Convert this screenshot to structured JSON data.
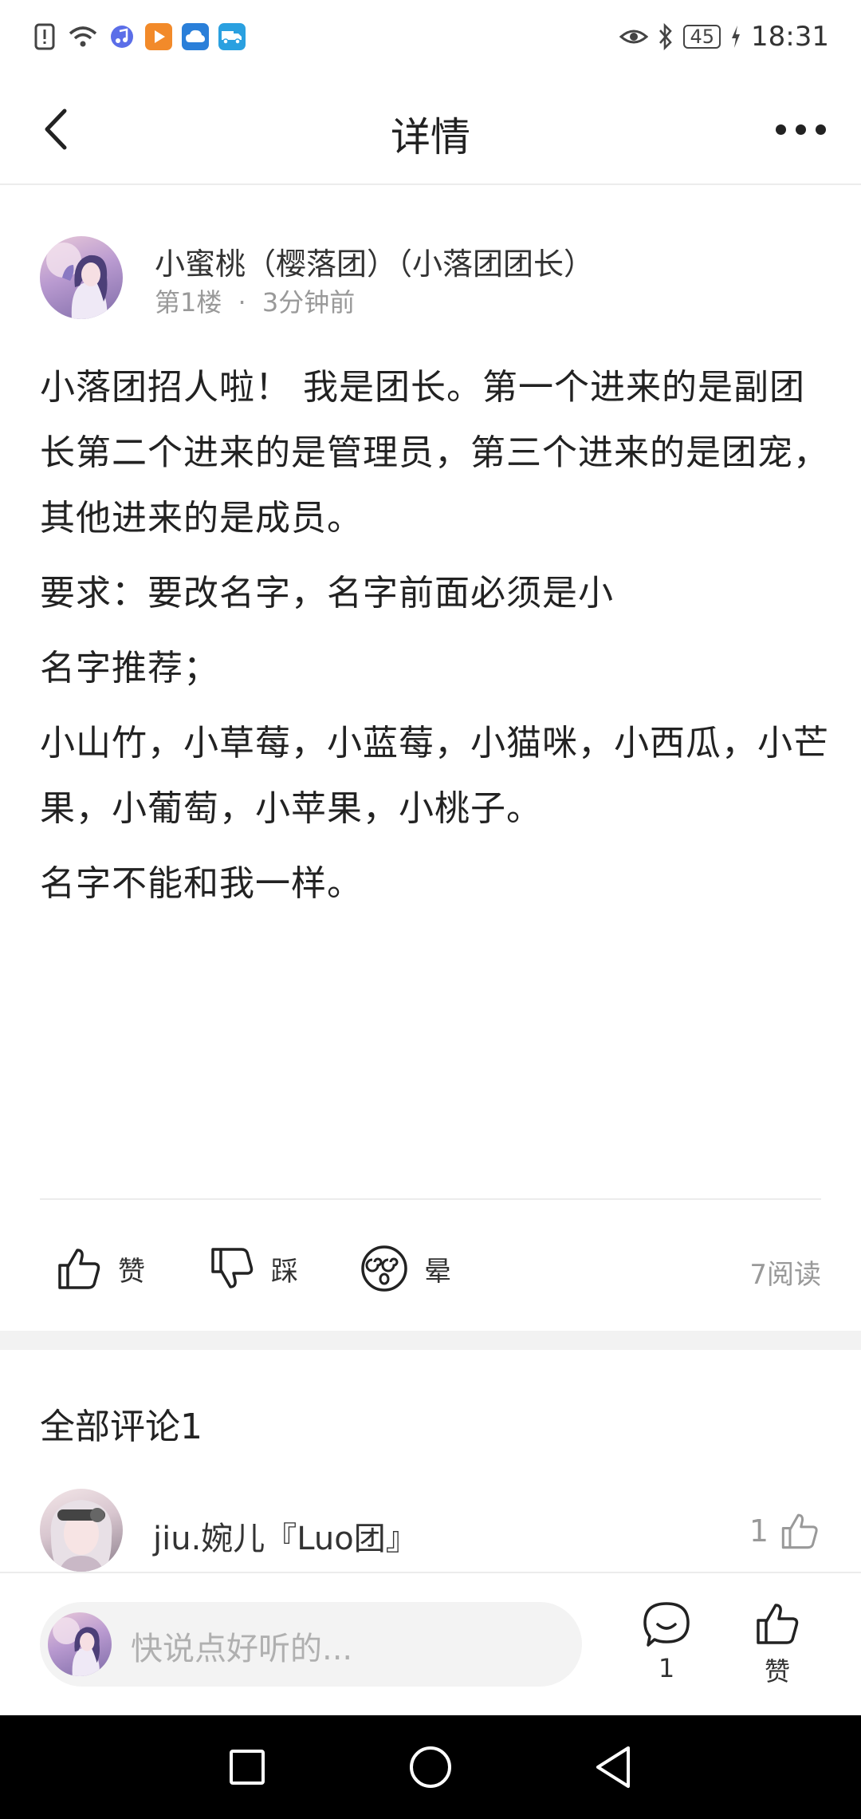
{
  "status_bar": {
    "time": "18:31",
    "battery": "45"
  },
  "header": {
    "title": "详情"
  },
  "post": {
    "author_name": "小蜜桃（樱落团）（小落团团长）",
    "floor": "第1楼",
    "separator": "·",
    "time_ago": "3分钟前",
    "paragraphs": [
      "小落团招人啦！ 我是团长。第一个进来的是副团长第二个进来的是管理员，第三个进来的是团宠，其他进来的是成员。",
      "要求：要改名字，名字前面必须是小",
      "名字推荐；",
      "小山竹，小草莓，小蓝莓，小猫咪，小西瓜，小芒果，小葡萄，小苹果，小桃子。",
      "名字不能和我一样。"
    ]
  },
  "reactions": {
    "like_label": "赞",
    "dislike_label": "踩",
    "dizzy_label": "晕",
    "read_count": "7阅读"
  },
  "comments": {
    "title": "全部评论1",
    "items": [
      {
        "name": "jiu.婉儿『Luo团』",
        "likes": "1"
      }
    ]
  },
  "input_bar": {
    "placeholder": "快说点好听的...",
    "comment_count": "1",
    "like_label": "赞"
  },
  "colors": {
    "text": "#222222",
    "muted": "#999999",
    "divider": "#ececec",
    "nav_bar": "#000000"
  },
  "icons": [
    "back-arrow-icon",
    "more-dots-icon",
    "thumbs-up-icon",
    "thumbs-down-icon",
    "dizzy-face-icon",
    "comment-bubble-icon",
    "square-nav-icon",
    "circle-home-icon",
    "triangle-back-icon"
  ]
}
